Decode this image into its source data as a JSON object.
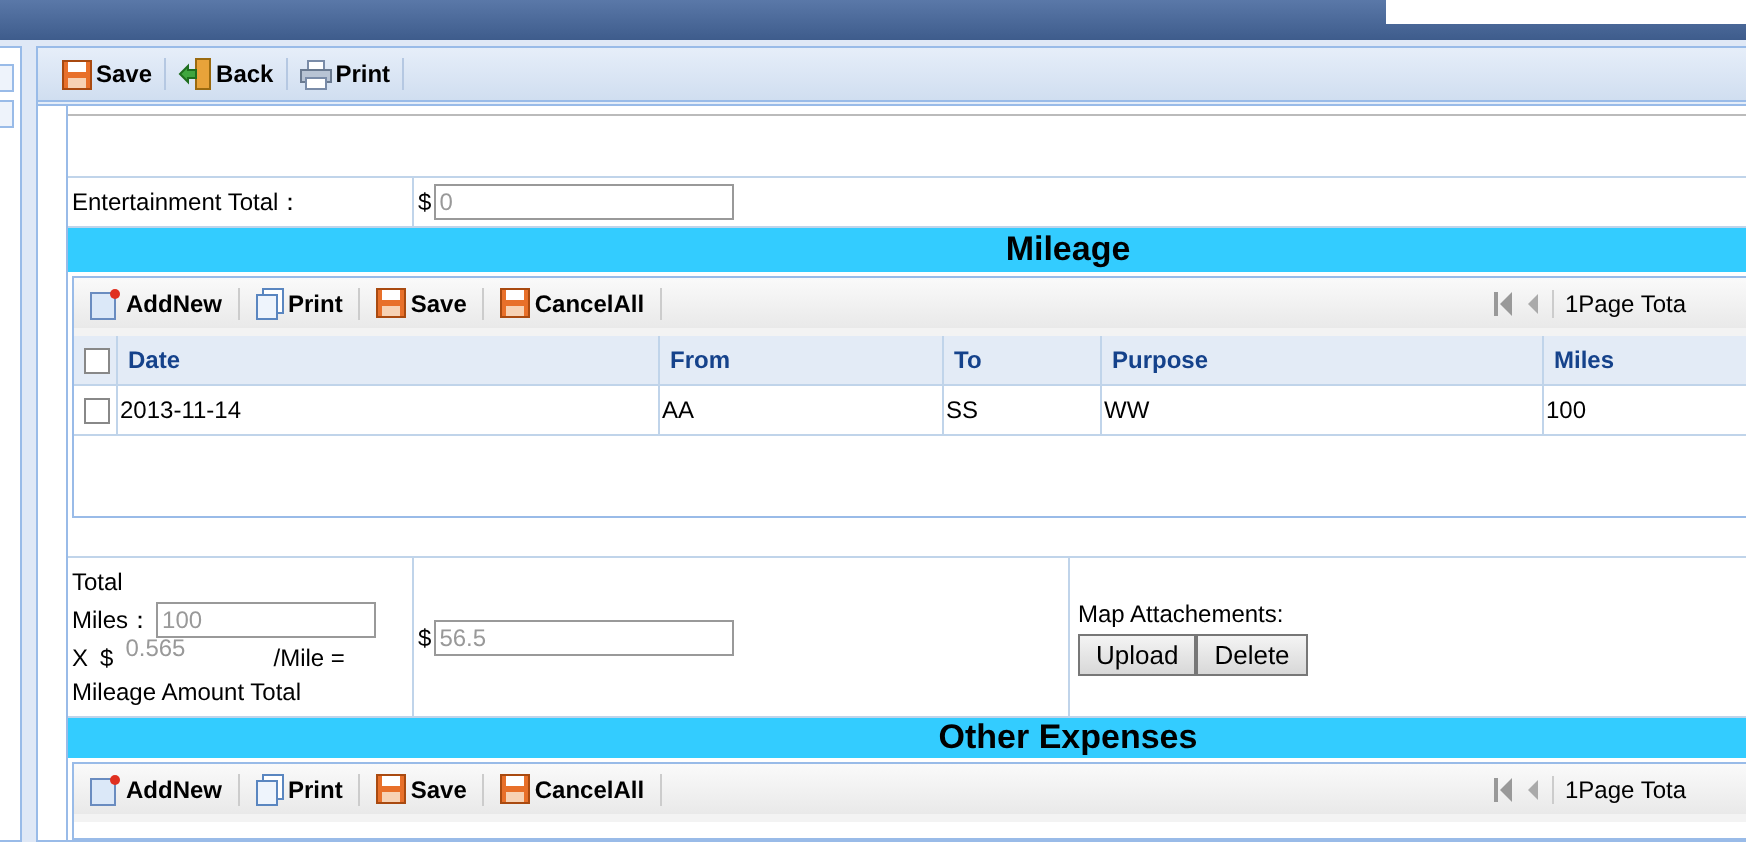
{
  "toolbar": [
    "Save",
    "Back",
    "Print"
  ],
  "entertainment": {
    "label": "Entertainment Total：",
    "currency": "$",
    "value": "0"
  },
  "mileage": {
    "title": "Mileage",
    "toolbar": [
      "AddNew",
      "Print",
      "Save",
      "CancelAll"
    ],
    "pager": "1Page Tota",
    "all_checked": false,
    "columns": [
      "Date",
      "From",
      "To",
      "Purpose",
      "Miles"
    ],
    "rows": [
      {
        "checked": false,
        "cells": [
          "2013-11-14",
          "AA",
          "SS",
          "WW",
          "100"
        ]
      }
    ],
    "totals": {
      "total_label": "Total",
      "miles_label": "Miles：",
      "miles_value": "100",
      "times": "X",
      "currency": "$",
      "rate": "0.565",
      "per_mile": "/Mile =",
      "amount_label": "Mileage Amount Total",
      "amount_currency": "$",
      "amount_value": "56.5",
      "attachments_label": "Map Attachements:",
      "buttons": [
        "Upload",
        "Delete"
      ]
    }
  },
  "other_expenses": {
    "title": "Other Expenses",
    "toolbar": [
      "AddNew",
      "Print",
      "Save",
      "CancelAll"
    ],
    "pager": "1Page Tota"
  }
}
